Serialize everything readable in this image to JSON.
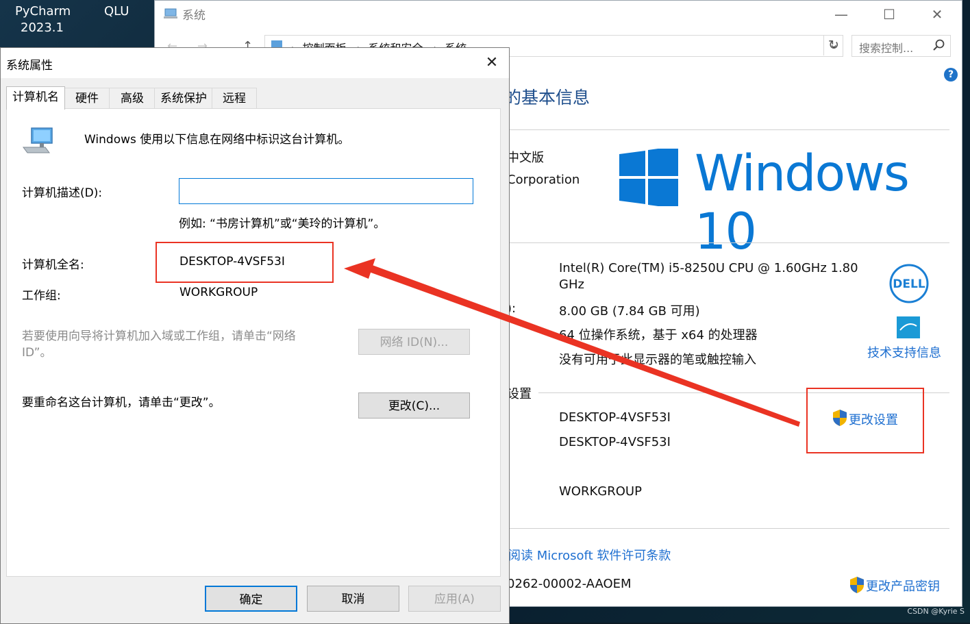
{
  "desktop": {
    "app_label_1": "PyCharm",
    "app_label_2": "2023.1",
    "app_label_3": "QLU",
    "watermark": "CSDN @Kyrie S"
  },
  "system_window": {
    "title": "系统",
    "breadcrumb": [
      "控制面板",
      "系统和安全",
      "系统"
    ],
    "search_placeholder": "搜索控制...",
    "heading": "的基本信息",
    "edition_partial": "中文版",
    "copyright_partial": "Corporation",
    "windows_logo_text": "Windows 10",
    "processor_line1": "Intel(R) Core(TM) i5-8250U CPU @ 1.60GHz   1.80",
    "processor_line2": "GHz",
    "ram_label_partial": "):",
    "ram_value": "8.00 GB (7.84 GB 可用)",
    "system_type": "64 位操作系统，基于 x64 的处理器",
    "pen_touch": "没有可用于此显示器的笔或触控输入",
    "support_link": "技术支持信息",
    "settings_section_partial": "设置",
    "computer_name": "DESKTOP-4VSF53I",
    "full_computer_name": "DESKTOP-4VSF53I",
    "workgroup": "WORKGROUP",
    "change_settings_link": "更改设置",
    "license_link_partial": "阅读 Microsoft 软件许可条款",
    "product_id_partial": "0262-00002-AAOEM",
    "change_key_link": "更改产品密钥",
    "colors": {
      "accent": "#0a78d4",
      "link": "#1e6fd0",
      "highlight": "#ea3323"
    }
  },
  "dialog": {
    "title": "系统属性",
    "tabs": [
      {
        "label": "计算机名",
        "active": true
      },
      {
        "label": "硬件",
        "active": false
      },
      {
        "label": "高级",
        "active": false
      },
      {
        "label": "系统保护",
        "active": false
      },
      {
        "label": "远程",
        "active": false
      }
    ],
    "intro": "Windows 使用以下信息在网络中标识这台计算机。",
    "desc_label": "计算机描述(D):",
    "desc_value": "",
    "example": "例如: “书房计算机”或“美玲的计算机”。",
    "fullname_label": "计算机全名:",
    "fullname_value": "DESKTOP-4VSF53I",
    "workgroup_label": "工作组:",
    "workgroup_value": "WORKGROUP",
    "network_hint": "若要使用向导将计算机加入域或工作组，请单击“网络 ID”。",
    "network_id_button": "网络 ID(N)...",
    "rename_hint": "要重命名这台计算机，请单击“更改”。",
    "change_button": "更改(C)...",
    "ok_button": "确定",
    "cancel_button": "取消",
    "apply_button": "应用(A)"
  }
}
